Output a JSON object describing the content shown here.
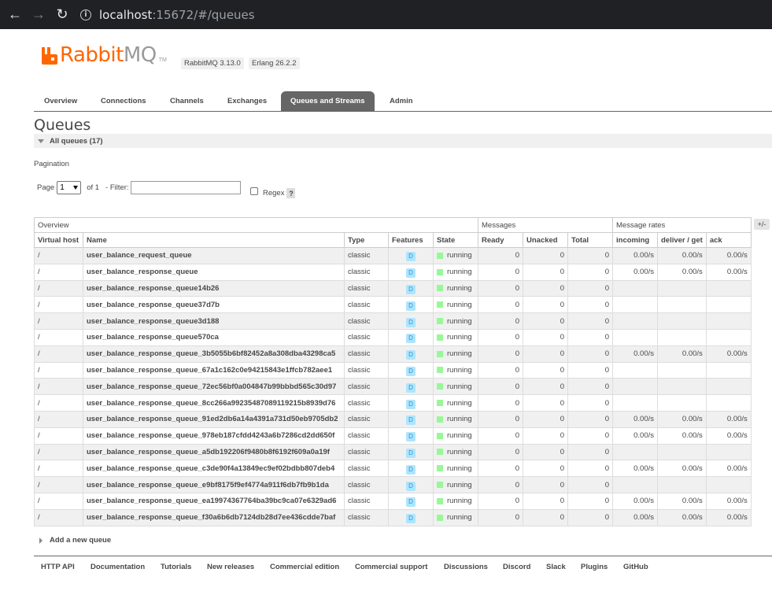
{
  "browser": {
    "url_host": "localhost",
    "url_rest": ":15672/#/queues"
  },
  "header": {
    "logo_rabbit": "Rabbit",
    "logo_mq": "MQ",
    "logo_tm": "TM",
    "brand_color": "#ff6600",
    "version_rabbitmq": "RabbitMQ 3.13.0",
    "version_erlang": "Erlang 26.2.2"
  },
  "tabs": [
    {
      "label": "Overview"
    },
    {
      "label": "Connections"
    },
    {
      "label": "Channels"
    },
    {
      "label": "Exchanges"
    },
    {
      "label": "Queues and Streams",
      "active": true
    },
    {
      "label": "Admin"
    }
  ],
  "page": {
    "title": "Queues",
    "section_label": "All queues (17)",
    "pagination_heading": "Pagination",
    "page_label": "Page",
    "page_value": "1",
    "of_label": "of 1",
    "filter_label": "- Filter:",
    "regex_label": "Regex",
    "help_label": "?",
    "columns_toggle": "+/-",
    "add_queue_label": "Add a new queue"
  },
  "table": {
    "groups": [
      "Overview",
      "Messages",
      "Message rates"
    ],
    "headers": [
      "Virtual host",
      "Name",
      "Type",
      "Features",
      "State",
      "Ready",
      "Unacked",
      "Total",
      "incoming",
      "deliver / get",
      "ack"
    ],
    "rows": [
      {
        "vhost": "/",
        "name": "user_balance_request_queue",
        "type": "classic",
        "feature": "D",
        "state": "running",
        "ready": "0",
        "unacked": "0",
        "total": "0",
        "incoming": "0.00/s",
        "deliver": "0.00/s",
        "ack": "0.00/s"
      },
      {
        "vhost": "/",
        "name": "user_balance_response_queue",
        "type": "classic",
        "feature": "D",
        "state": "running",
        "ready": "0",
        "unacked": "0",
        "total": "0",
        "incoming": "0.00/s",
        "deliver": "0.00/s",
        "ack": "0.00/s"
      },
      {
        "vhost": "/",
        "name": "user_balance_response_queue14b26",
        "type": "classic",
        "feature": "D",
        "state": "running",
        "ready": "0",
        "unacked": "0",
        "total": "0",
        "incoming": "",
        "deliver": "",
        "ack": ""
      },
      {
        "vhost": "/",
        "name": "user_balance_response_queue37d7b",
        "type": "classic",
        "feature": "D",
        "state": "running",
        "ready": "0",
        "unacked": "0",
        "total": "0",
        "incoming": "",
        "deliver": "",
        "ack": ""
      },
      {
        "vhost": "/",
        "name": "user_balance_response_queue3d188",
        "type": "classic",
        "feature": "D",
        "state": "running",
        "ready": "0",
        "unacked": "0",
        "total": "0",
        "incoming": "",
        "deliver": "",
        "ack": ""
      },
      {
        "vhost": "/",
        "name": "user_balance_response_queue570ca",
        "type": "classic",
        "feature": "D",
        "state": "running",
        "ready": "0",
        "unacked": "0",
        "total": "0",
        "incoming": "",
        "deliver": "",
        "ack": ""
      },
      {
        "vhost": "/",
        "name": "user_balance_response_queue_3b5055b6bf82452a8a308dba43298ca5",
        "type": "classic",
        "feature": "D",
        "state": "running",
        "ready": "0",
        "unacked": "0",
        "total": "0",
        "incoming": "0.00/s",
        "deliver": "0.00/s",
        "ack": "0.00/s"
      },
      {
        "vhost": "/",
        "name": "user_balance_response_queue_67a1c162c0e94215843e1ffcb782aee1",
        "type": "classic",
        "feature": "D",
        "state": "running",
        "ready": "0",
        "unacked": "0",
        "total": "0",
        "incoming": "",
        "deliver": "",
        "ack": ""
      },
      {
        "vhost": "/",
        "name": "user_balance_response_queue_72ec56bf0a004847b99bbbd565c30d97",
        "type": "classic",
        "feature": "D",
        "state": "running",
        "ready": "0",
        "unacked": "0",
        "total": "0",
        "incoming": "",
        "deliver": "",
        "ack": ""
      },
      {
        "vhost": "/",
        "name": "user_balance_response_queue_8cc266a99235487089119215b8939d76",
        "type": "classic",
        "feature": "D",
        "state": "running",
        "ready": "0",
        "unacked": "0",
        "total": "0",
        "incoming": "",
        "deliver": "",
        "ack": ""
      },
      {
        "vhost": "/",
        "name": "user_balance_response_queue_91ed2db6a14a4391a731d50eb9705db2",
        "type": "classic",
        "feature": "D",
        "state": "running",
        "ready": "0",
        "unacked": "0",
        "total": "0",
        "incoming": "0.00/s",
        "deliver": "0.00/s",
        "ack": "0.00/s"
      },
      {
        "vhost": "/",
        "name": "user_balance_response_queue_978eb187cfdd4243a6b7286cd2dd650f",
        "type": "classic",
        "feature": "D",
        "state": "running",
        "ready": "0",
        "unacked": "0",
        "total": "0",
        "incoming": "0.00/s",
        "deliver": "0.00/s",
        "ack": "0.00/s"
      },
      {
        "vhost": "/",
        "name": "user_balance_response_queue_a5db192206f9480b8f6192f609a0a19f",
        "type": "classic",
        "feature": "D",
        "state": "running",
        "ready": "0",
        "unacked": "0",
        "total": "0",
        "incoming": "",
        "deliver": "",
        "ack": ""
      },
      {
        "vhost": "/",
        "name": "user_balance_response_queue_c3de90f4a13849ec9ef02bdbb807deb4",
        "type": "classic",
        "feature": "D",
        "state": "running",
        "ready": "0",
        "unacked": "0",
        "total": "0",
        "incoming": "0.00/s",
        "deliver": "0.00/s",
        "ack": "0.00/s"
      },
      {
        "vhost": "/",
        "name": "user_balance_response_queue_e9bf8175f9ef4774a911f6db7fb9b1da",
        "type": "classic",
        "feature": "D",
        "state": "running",
        "ready": "0",
        "unacked": "0",
        "total": "0",
        "incoming": "",
        "deliver": "",
        "ack": ""
      },
      {
        "vhost": "/",
        "name": "user_balance_response_queue_ea19974367764ba39bc9ca07e6329ad6",
        "type": "classic",
        "feature": "D",
        "state": "running",
        "ready": "0",
        "unacked": "0",
        "total": "0",
        "incoming": "0.00/s",
        "deliver": "0.00/s",
        "ack": "0.00/s"
      },
      {
        "vhost": "/",
        "name": "user_balance_response_queue_f30a6b6db7124db28d7ee436cdde7baf",
        "type": "classic",
        "feature": "D",
        "state": "running",
        "ready": "0",
        "unacked": "0",
        "total": "0",
        "incoming": "0.00/s",
        "deliver": "0.00/s",
        "ack": "0.00/s"
      }
    ]
  },
  "footer": {
    "links": [
      "HTTP API",
      "Documentation",
      "Tutorials",
      "New releases",
      "Commercial edition",
      "Commercial support",
      "Discussions",
      "Discord",
      "Slack",
      "Plugins",
      "GitHub"
    ]
  }
}
